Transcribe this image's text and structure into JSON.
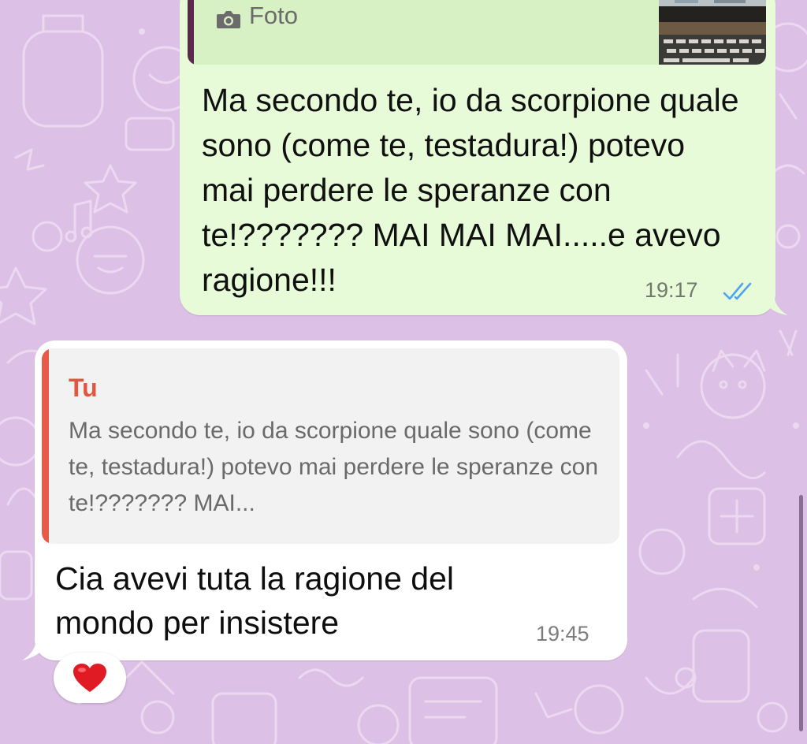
{
  "chat": {
    "outgoing": {
      "quote_label": "Foto",
      "text": "Ma secondo te, io da scorpione quale sono (come te, testadura!) potevo mai perdere le speranze con te!??????? MAI MAI MAI.....e avevo ragione!!!",
      "time": "19:17",
      "status_icon": "double-check-read-icon"
    },
    "incoming": {
      "quote_author": "Tu",
      "quote_text": "Ma secondo te, io da scorpione quale sono (come te, testadura!) potevo mai perdere le speranze con te!??????? MAI...",
      "text": "Cia avevi tuta la ragione del mondo per insistere",
      "time": "19:45",
      "reaction": "❤️"
    }
  },
  "colors": {
    "wallpaper": "#dcc0e6",
    "outgoing_bubble": "#e8fbd8",
    "incoming_bubble": "#ffffff",
    "quote_author": "#e2563f",
    "read_ticks": "#4fa3f0"
  }
}
